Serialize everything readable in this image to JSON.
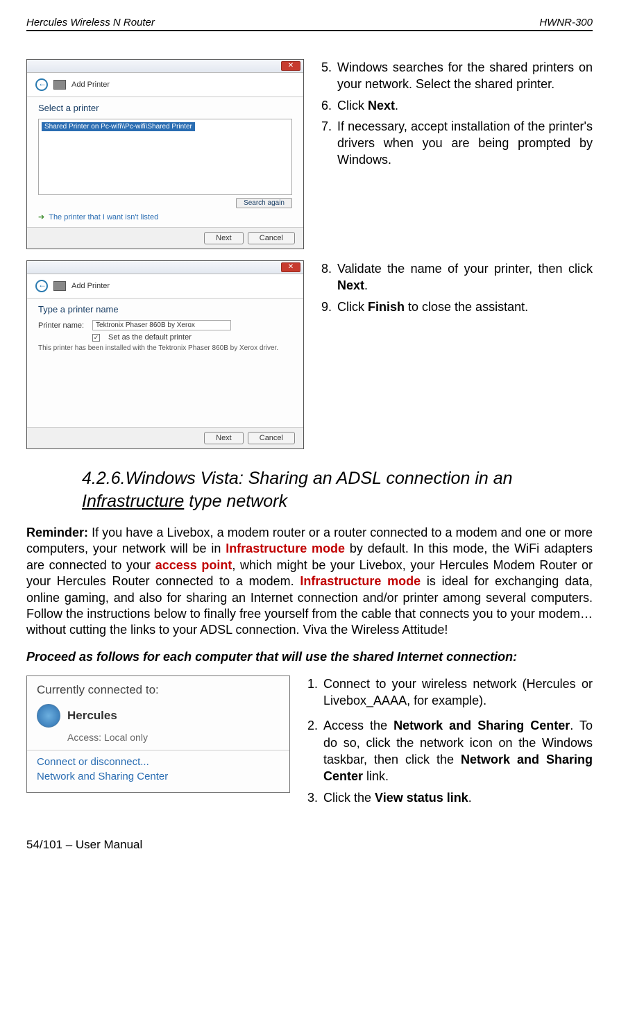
{
  "header": {
    "left": "Hercules Wireless N Router",
    "right": "HWNR-300"
  },
  "screenshot1": {
    "dialogTitle": "Add Printer",
    "heading": "Select a printer",
    "selectedItem": "Shared Printer on Pc-wifi\\\\Pc-wifi\\Shared Printer",
    "searchAgain": "Search again",
    "notListed": "The printer that I want isn't listed",
    "next": "Next",
    "cancel": "Cancel"
  },
  "steps1": {
    "s5": "Windows searches for the shared printers on your network. Select the shared printer.",
    "s6_pre": "Click ",
    "s6_bold": "Next",
    "s6_post": ".",
    "s7": "If necessary, accept installation of the printer's drivers when you are being prompted by Windows."
  },
  "screenshot2": {
    "dialogTitle": "Add Printer",
    "heading": "Type a printer name",
    "nameLabel": "Printer name:",
    "nameValue": "Tektronix Phaser 860B by Xerox",
    "defaultLabel": "Set as the default printer",
    "installedMsg": "This printer has been installed with the Tektronix Phaser 860B by Xerox driver.",
    "next": "Next",
    "cancel": "Cancel"
  },
  "steps2": {
    "s8_pre": "Validate the name of your printer, then click ",
    "s8_bold": "Next",
    "s8_post": ".",
    "s9_pre": "Click ",
    "s9_bold": "Finish",
    "s9_post": " to close the assistant."
  },
  "sectionTitle": {
    "num": "4.2.6.",
    "line1": "Windows Vista:  Sharing  an  ADSL  connection  in  an ",
    "underline": "Infrastructure",
    "line2": " type network"
  },
  "reminder": {
    "pre": "Reminder:",
    "text1": " If you have a Livebox, a modem router or a router connected to a modem and one or more computers, your network will be in ",
    "infra1": "Infrastructure mode",
    "text2": " by default.  In this mode, the WiFi adapters are connected to your ",
    "ap": "access point",
    "text3": ", which might be your Livebox, your Hercules Modem Router or your Hercules Router connected to a modem.  ",
    "infra2": "Infrastructure mode",
    "text4": " is ideal for exchanging data, online gaming, and also for sharing an Internet connection and/or printer among several computers.  Follow the instructions below to finally free yourself from the cable that connects you to your modem… without cutting the links to your ADSL connection.  Viva the Wireless Attitude!"
  },
  "proceed": "Proceed as follows for each computer that will use the shared Internet connection:",
  "networkBox": {
    "currently": "Currently connected to:",
    "name": "Hercules",
    "access": "Access:  Local only",
    "connect": "Connect or disconnect...",
    "center": "Network and Sharing Center"
  },
  "steps3": {
    "s1": "Connect to your wireless network (Hercules or Livebox_AAAA, for example).",
    "s2_pre": "Access the ",
    "s2_b1": "Network and Sharing Center",
    "s2_mid": ".  To do so, click the network icon on the Windows taskbar, then click the ",
    "s2_b2": "Network and Sharing Center",
    "s2_post": " link.",
    "s3_pre": "Click the ",
    "s3_bold": "View status link",
    "s3_post": "."
  },
  "footer": "54/101 – User Manual"
}
